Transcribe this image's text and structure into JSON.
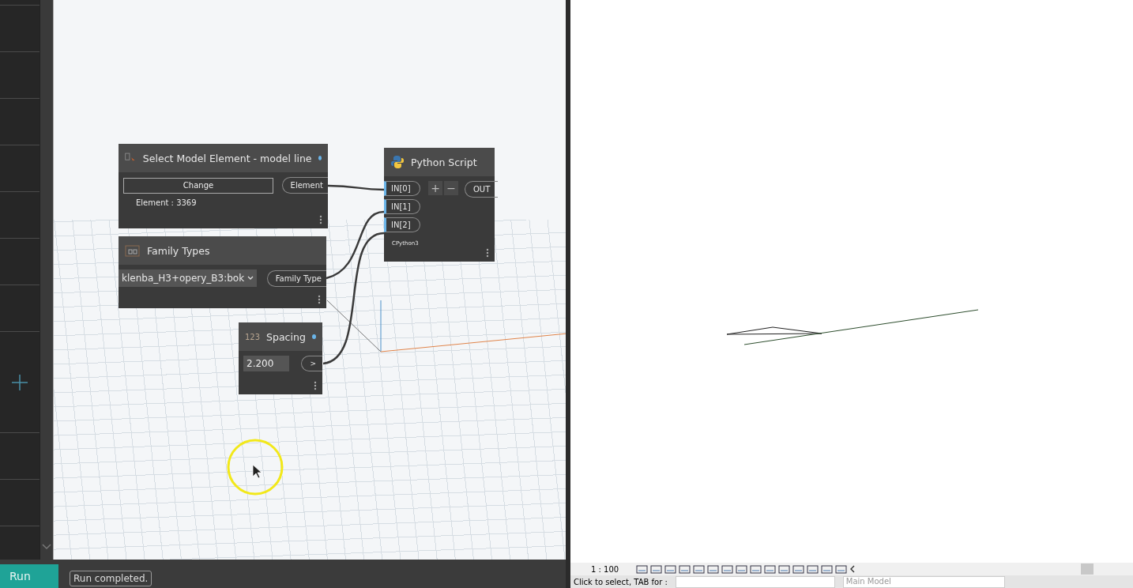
{
  "nodes": [
    {
      "kind": "select",
      "title": "Select Model Element - model line",
      "preview_dot": true,
      "button": "Change",
      "output": "Element",
      "info": "Element : 3369"
    },
    {
      "kind": "dropdown",
      "title": "Family Types",
      "value": "klenba_H3+opery_B3:bok",
      "output": "Family Type"
    },
    {
      "kind": "number",
      "title": "Spacing",
      "icon_text": "123",
      "preview_dot": true,
      "value": "2.200",
      "output": ">"
    },
    {
      "kind": "python",
      "title": "Python Script",
      "inputs": [
        "IN[0]",
        "IN[1]",
        "IN[2]"
      ],
      "add": "+",
      "remove": "−",
      "output": "OUT",
      "engine": "CPython3"
    }
  ],
  "run": {
    "label": "Run",
    "status": "Run completed."
  },
  "revit": {
    "scale": "1 : 100",
    "status": "Click to select, TAB for :",
    "model": "Main Model"
  }
}
